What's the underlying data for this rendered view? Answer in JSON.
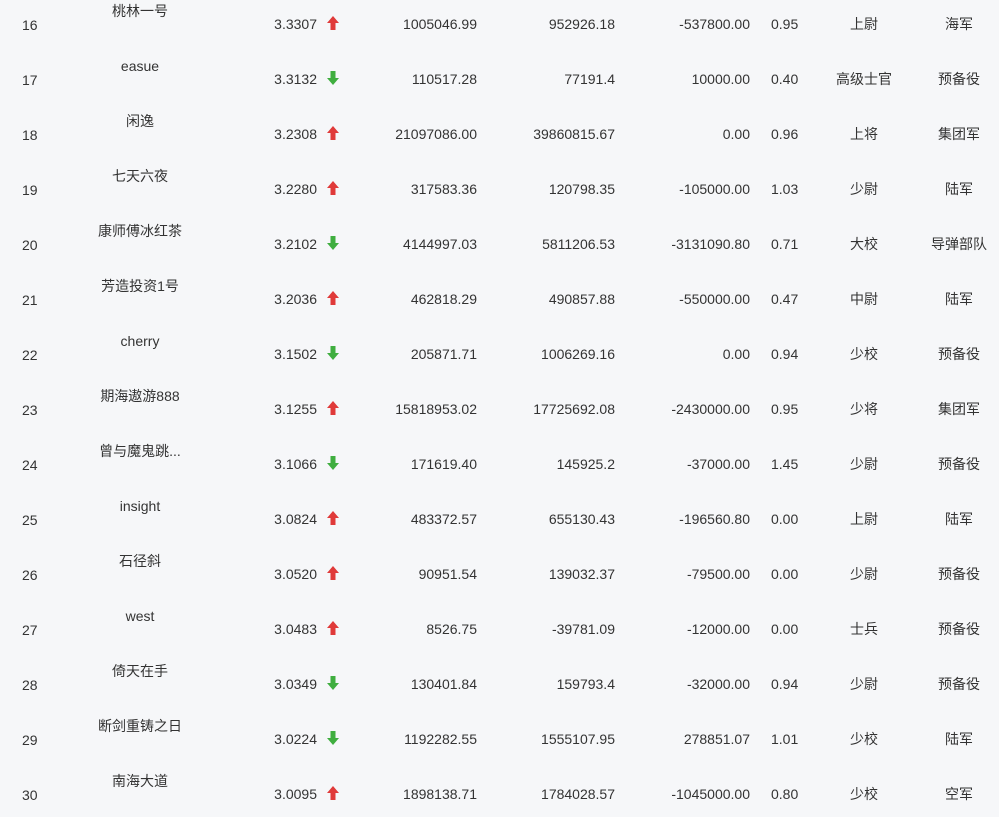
{
  "colors": {
    "up": "#e03a3a",
    "down": "#3fae3f",
    "text": "#333333",
    "background": "#f6f7f9"
  },
  "rows": [
    {
      "rank": "16",
      "name": "桃林一号",
      "net": "3.3307",
      "trend": "up",
      "c1": "1005046.99",
      "c2": "952926.18",
      "c3": "-537800.00",
      "ratio": "0.95",
      "level": "上尉",
      "branch": "海军"
    },
    {
      "rank": "17",
      "name": "easue",
      "net": "3.3132",
      "trend": "down",
      "c1": "110517.28",
      "c2": "77191.4",
      "c3": "10000.00",
      "ratio": "0.40",
      "level": "高级士官",
      "branch": "预备役"
    },
    {
      "rank": "18",
      "name": "闲逸",
      "net": "3.2308",
      "trend": "up",
      "c1": "21097086.00",
      "c2": "39860815.67",
      "c3": "0.00",
      "ratio": "0.96",
      "level": "上将",
      "branch": "集团军"
    },
    {
      "rank": "19",
      "name": "七天六夜",
      "net": "3.2280",
      "trend": "up",
      "c1": "317583.36",
      "c2": "120798.35",
      "c3": "-105000.00",
      "ratio": "1.03",
      "level": "少尉",
      "branch": "陆军"
    },
    {
      "rank": "20",
      "name": "康师傅冰红茶",
      "net": "3.2102",
      "trend": "down",
      "c1": "4144997.03",
      "c2": "5811206.53",
      "c3": "-3131090.80",
      "ratio": "0.71",
      "level": "大校",
      "branch": "导弹部队"
    },
    {
      "rank": "21",
      "name": "芳造投资1号",
      "net": "3.2036",
      "trend": "up",
      "c1": "462818.29",
      "c2": "490857.88",
      "c3": "-550000.00",
      "ratio": "0.47",
      "level": "中尉",
      "branch": "陆军"
    },
    {
      "rank": "22",
      "name": "cherry",
      "net": "3.1502",
      "trend": "down",
      "c1": "205871.71",
      "c2": "1006269.16",
      "c3": "0.00",
      "ratio": "0.94",
      "level": "少校",
      "branch": "预备役"
    },
    {
      "rank": "23",
      "name": "期海遨游888",
      "net": "3.1255",
      "trend": "up",
      "c1": "15818953.02",
      "c2": "17725692.08",
      "c3": "-2430000.00",
      "ratio": "0.95",
      "level": "少将",
      "branch": "集团军"
    },
    {
      "rank": "24",
      "name": "曾与魔鬼跳...",
      "net": "3.1066",
      "trend": "down",
      "c1": "171619.40",
      "c2": "145925.2",
      "c3": "-37000.00",
      "ratio": "1.45",
      "level": "少尉",
      "branch": "预备役"
    },
    {
      "rank": "25",
      "name": "insight",
      "net": "3.0824",
      "trend": "up",
      "c1": "483372.57",
      "c2": "655130.43",
      "c3": "-196560.80",
      "ratio": "0.00",
      "level": "上尉",
      "branch": "陆军"
    },
    {
      "rank": "26",
      "name": "石径斜",
      "net": "3.0520",
      "trend": "up",
      "c1": "90951.54",
      "c2": "139032.37",
      "c3": "-79500.00",
      "ratio": "0.00",
      "level": "少尉",
      "branch": "预备役"
    },
    {
      "rank": "27",
      "name": "west",
      "net": "3.0483",
      "trend": "up",
      "c1": "8526.75",
      "c2": "-39781.09",
      "c3": "-12000.00",
      "ratio": "0.00",
      "level": "士兵",
      "branch": "预备役"
    },
    {
      "rank": "28",
      "name": "倚天在手",
      "net": "3.0349",
      "trend": "down",
      "c1": "130401.84",
      "c2": "159793.4",
      "c3": "-32000.00",
      "ratio": "0.94",
      "level": "少尉",
      "branch": "预备役"
    },
    {
      "rank": "29",
      "name": "断剑重铸之日",
      "net": "3.0224",
      "trend": "down",
      "c1": "1192282.55",
      "c2": "1555107.95",
      "c3": "278851.07",
      "ratio": "1.01",
      "level": "少校",
      "branch": "陆军"
    },
    {
      "rank": "30",
      "name": "南海大道",
      "net": "3.0095",
      "trend": "up",
      "c1": "1898138.71",
      "c2": "1784028.57",
      "c3": "-1045000.00",
      "ratio": "0.80",
      "level": "少校",
      "branch": "空军"
    }
  ]
}
